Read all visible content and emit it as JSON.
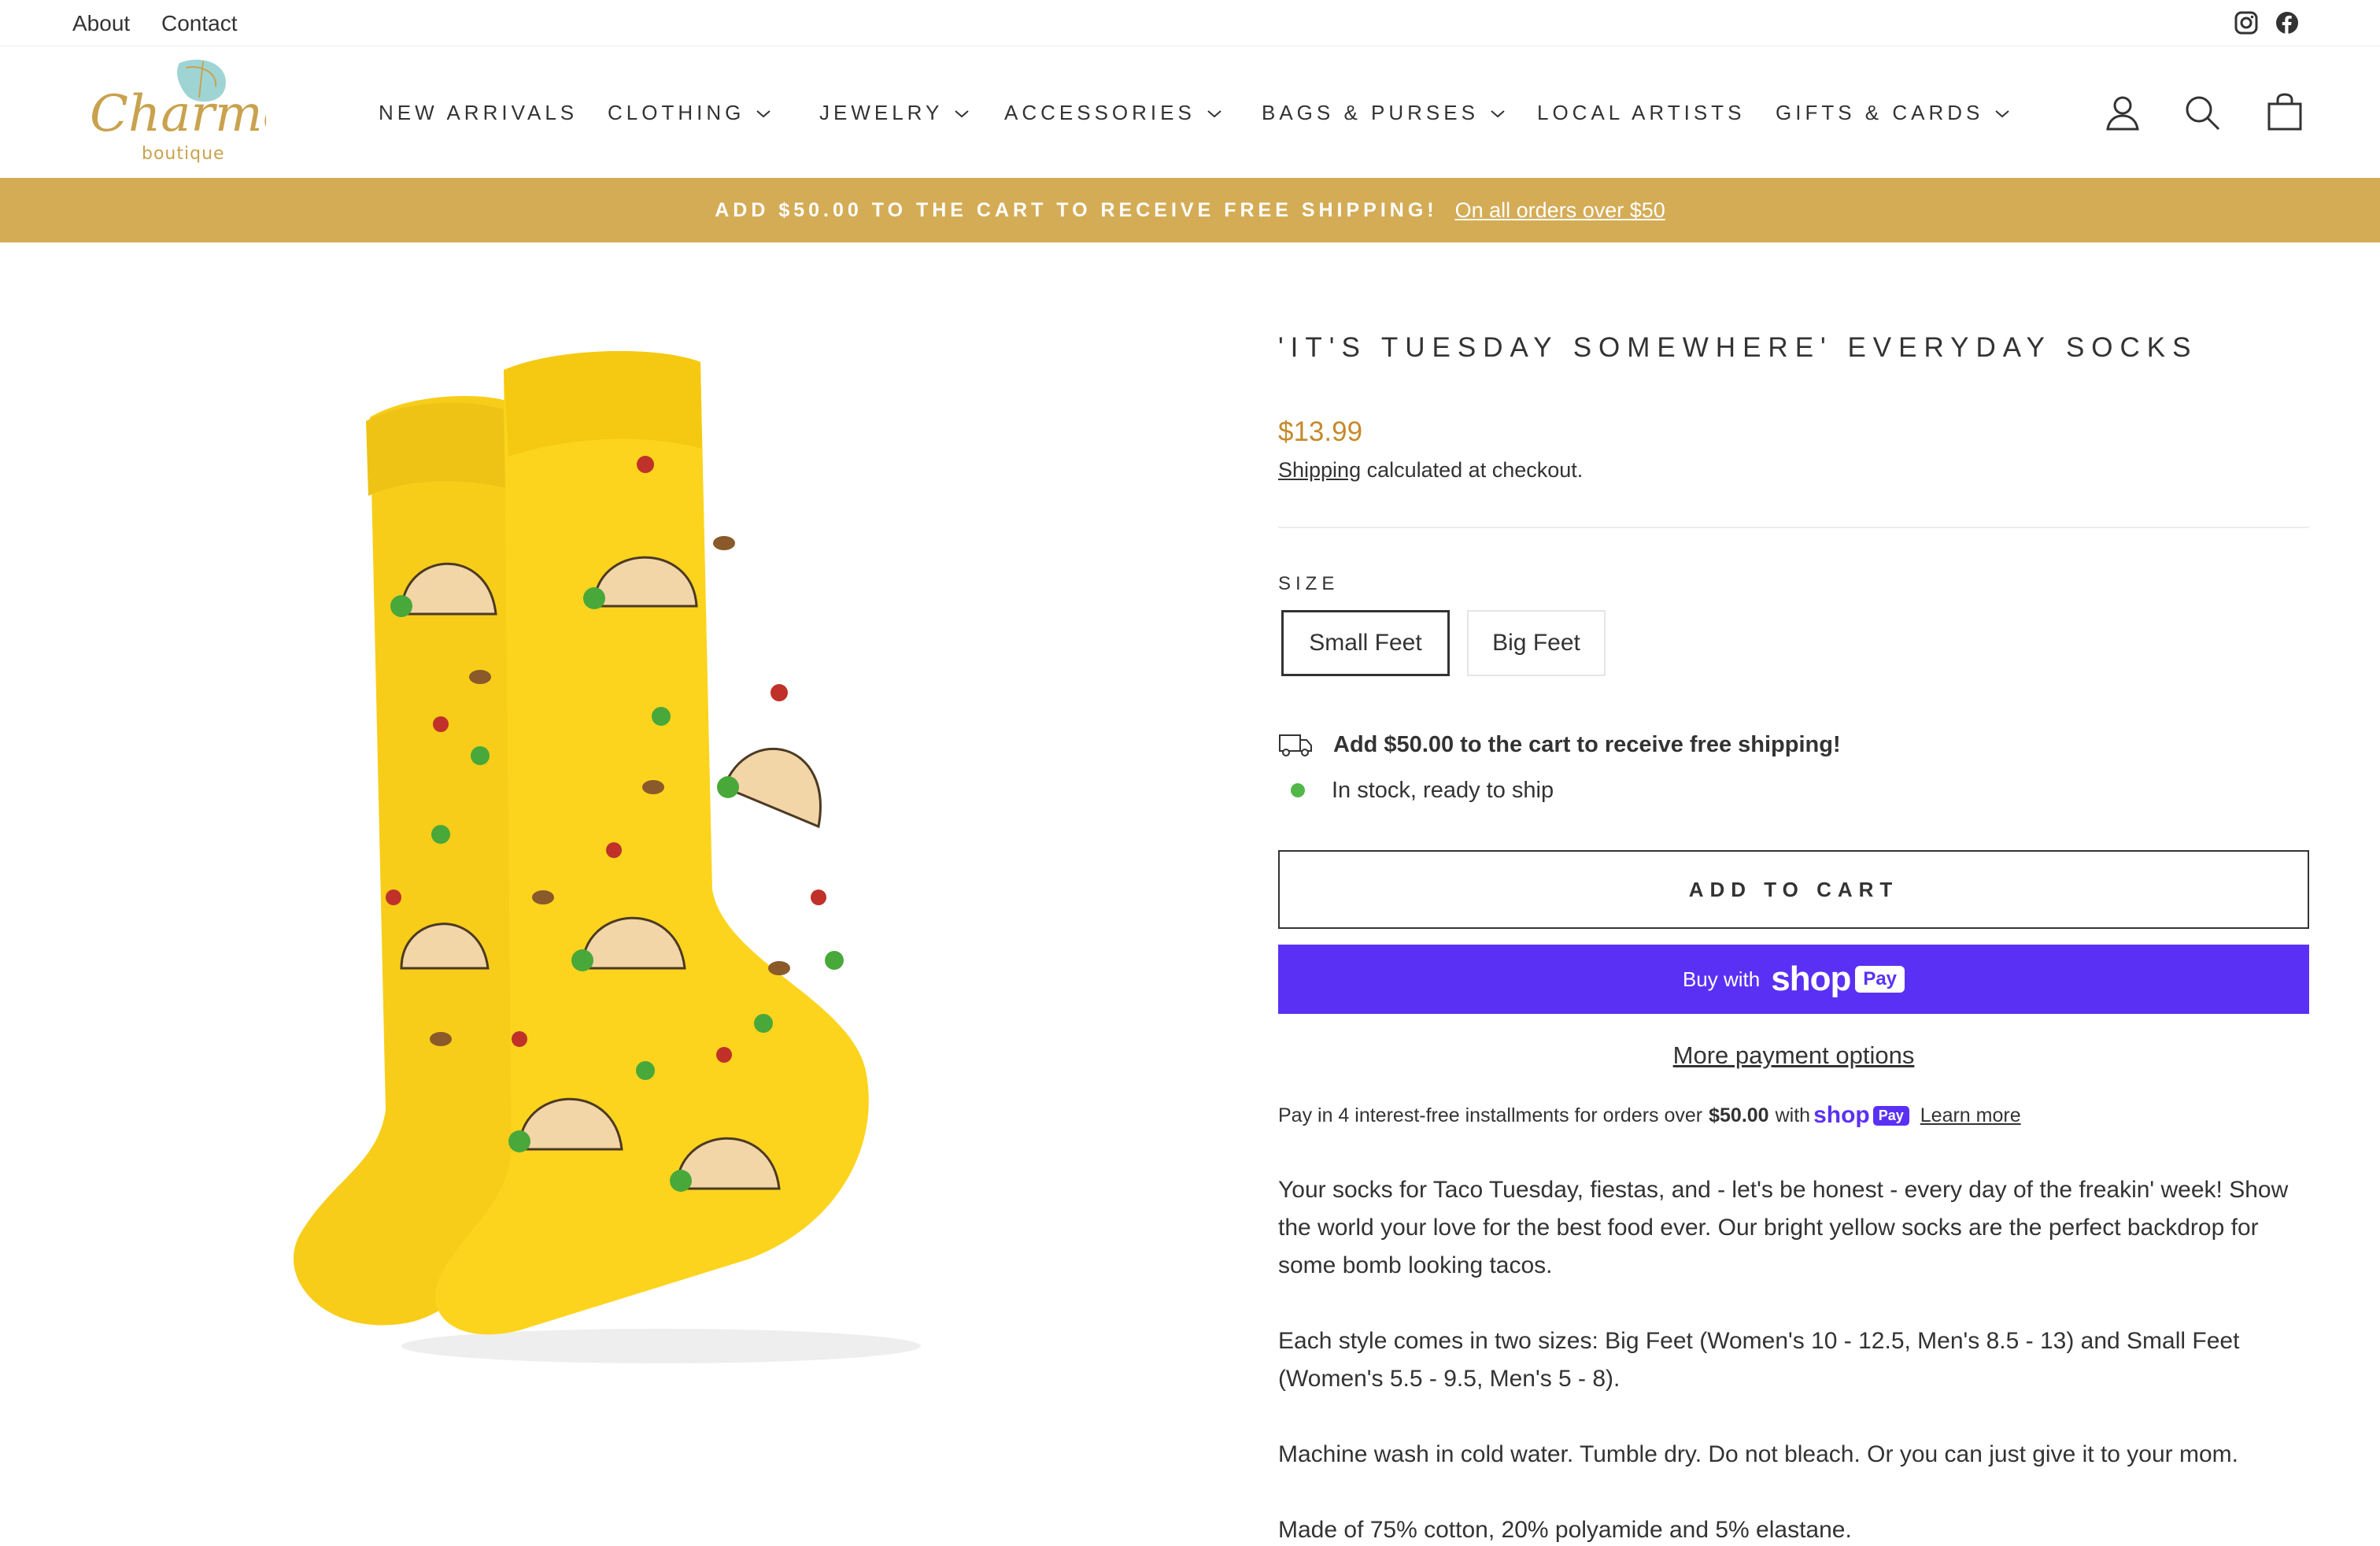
{
  "utility_bar": {
    "about": "About",
    "contact": "Contact",
    "social": [
      "instagram-icon",
      "facebook-icon"
    ]
  },
  "header": {
    "logo_script": "Charmed",
    "logo_sub": "boutique",
    "nav": [
      {
        "label": "NEW ARRIVALS",
        "dropdown": false
      },
      {
        "label": "CLOTHING",
        "dropdown": true
      },
      {
        "label": "JEWELRY",
        "dropdown": true
      },
      {
        "label": "ACCESSORIES",
        "dropdown": true
      },
      {
        "label": "BAGS & PURSES",
        "dropdown": true
      },
      {
        "label": "LOCAL ARTISTS",
        "dropdown": false
      },
      {
        "label": "GIFTS & CARDS",
        "dropdown": true
      }
    ],
    "icons": [
      "account-icon",
      "search-icon",
      "cart-icon"
    ]
  },
  "announcement": {
    "message": "ADD $50.00 TO THE CART TO RECEIVE FREE SHIPPING!",
    "link": "On all orders over $50",
    "color": "#d4ac56"
  },
  "product": {
    "title": "'IT'S TUESDAY SOMEWHERE' EVERYDAY SOCKS",
    "price": "$13.99",
    "price_color": "#c58a2c",
    "shipping_link": "Shipping",
    "shipping_rest": " calculated at checkout.",
    "size_label": "SIZE",
    "sizes": [
      "Small Feet",
      "Big Feet"
    ],
    "selected_size": "Small Feet",
    "free_shipping_msg": "Add $50.00 to the cart to receive free shipping!",
    "stock_msg": "In stock, ready to ship",
    "add_to_cart": "ADD TO CART",
    "shop_pay": {
      "buy_with": "Buy with",
      "brand": "shop",
      "badge": "Pay",
      "color": "#5a31f4"
    },
    "more_payment": "More payment options",
    "installments": {
      "prefix": "Pay in 4 interest-free installments for orders over",
      "amount": "$50.00",
      "with": "with",
      "brand": "shop",
      "badge": "Pay",
      "learn_more": "Learn more"
    },
    "description": [
      "Your socks for Taco Tuesday, fiestas, and - let's be honest - every day of the freakin' week! Show the world your love for the best food ever. Our bright yellow socks are the perfect backdrop for some bomb looking tacos.",
      "Each style comes in two sizes: Big Feet (Women's 10 - 12.5, Men's 8.5 - 13) and Small Feet (Women's 5.5 - 9.5, Men's 5 - 8).",
      "Machine wash in cold water. Tumble dry. Do not bleach. Or you can just give it to your mom.",
      "Made of 75% cotton, 20% polyamide and 5% elastane."
    ]
  }
}
